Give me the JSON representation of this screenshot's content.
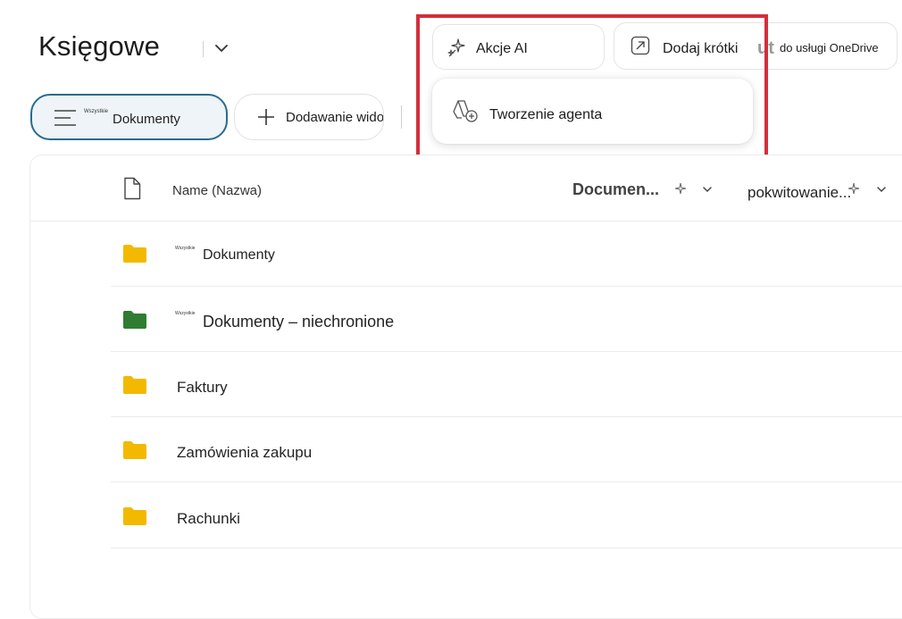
{
  "header": {
    "title": "Księgowe"
  },
  "views": {
    "current_prefix": "Wszystkie",
    "current_label": "Dokumenty",
    "add_view_label": "Dodawanie widoku"
  },
  "toolbar": {
    "ai_actions_label": "Akcje AI",
    "add_shortcut_label": "Dodaj krótki",
    "add_shortcut_ghost": "ut",
    "add_shortcut_suffix": "do usługi OneDrive"
  },
  "ai_menu": {
    "items": [
      {
        "label": "Tworzenie agenta"
      }
    ]
  },
  "list": {
    "columns": {
      "name": "Name (Nazwa)",
      "document": "Documen...",
      "acknowledgement": "pokwitowanie..."
    },
    "rows": [
      {
        "prefix": "Wszystkie",
        "name": "Dokumenty",
        "folder_color": "#f2b900"
      },
      {
        "prefix": "Wszystkie",
        "name": "Dokumenty – niechronione",
        "folder_color": "#2e7d32"
      },
      {
        "prefix": "",
        "name": "Faktury",
        "folder_color": "#f2b900"
      },
      {
        "prefix": "",
        "name": "Zamówienia zakupu",
        "folder_color": "#f2b900"
      },
      {
        "prefix": "",
        "name": "Rachunki",
        "folder_color": "#f2b900"
      }
    ]
  },
  "colors": {
    "highlight": "#d32f3a",
    "view_border": "#2a6b90"
  }
}
